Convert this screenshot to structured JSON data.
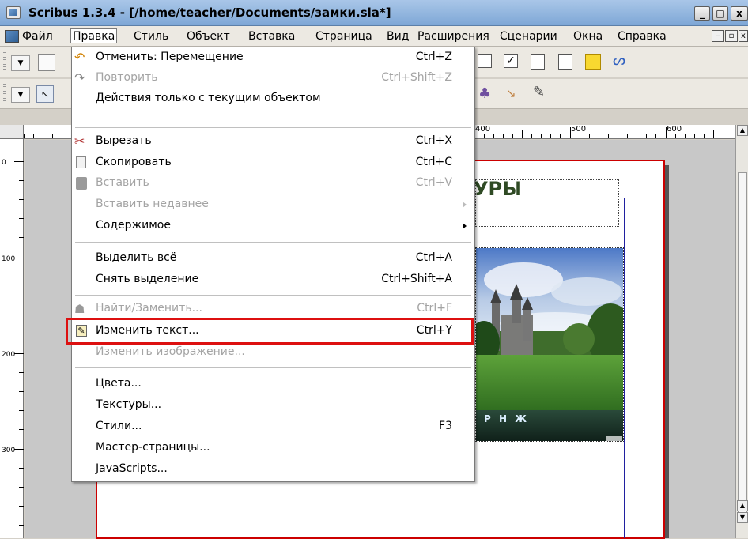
{
  "window": {
    "title": "Scribus 1.3.4 - [/home/teacher/Documents/замки.sla*]",
    "minimize_glyph": "_",
    "maximize_glyph": "□",
    "close_glyph": "x"
  },
  "menubar": {
    "items": [
      "Файл",
      "Правка",
      "Стиль",
      "Объект",
      "Вставка",
      "Страница",
      "Вид",
      "Расширения",
      "Сценарии",
      "Окна",
      "Справка"
    ],
    "active_index": 1
  },
  "ruler": {
    "h_labels": [
      "400",
      "500",
      "600"
    ],
    "v_labels": [
      "0",
      "100",
      "200",
      "300"
    ]
  },
  "canvas": {
    "headline": "УРЫ",
    "photo_caption": "Р Н Ж"
  },
  "edit_menu": {
    "items": [
      {
        "label": "Отменить: Перемещение",
        "shortcut": "Ctrl+Z",
        "enabled": true,
        "icon": "undo-icon"
      },
      {
        "label": "Повторить",
        "shortcut": "Ctrl+Shift+Z",
        "enabled": false,
        "icon": "redo-icon"
      },
      {
        "label": "Действия только с текущим объектом",
        "shortcut": "",
        "enabled": true,
        "icon": ""
      },
      {
        "label": "Вырезать",
        "shortcut": "Ctrl+X",
        "enabled": true,
        "icon": "scissors-icon"
      },
      {
        "label": "Скопировать",
        "shortcut": "Ctrl+C",
        "enabled": true,
        "icon": "copy-icon"
      },
      {
        "label": "Вставить",
        "shortcut": "Ctrl+V",
        "enabled": false,
        "icon": "paste-icon"
      },
      {
        "label": "Вставить недавнее",
        "shortcut": "",
        "enabled": false,
        "icon": "",
        "submenu": true
      },
      {
        "label": "Содержимое",
        "shortcut": "",
        "enabled": true,
        "icon": "",
        "submenu": true
      },
      {
        "label": "Выделить всё",
        "shortcut": "Ctrl+A",
        "enabled": true,
        "icon": ""
      },
      {
        "label": "Снять выделение",
        "shortcut": "Ctrl+Shift+A",
        "enabled": true,
        "icon": ""
      },
      {
        "label": "Найти/Заменить...",
        "shortcut": "Ctrl+F",
        "enabled": false,
        "icon": "find-icon"
      },
      {
        "label": "Изменить текст...",
        "shortcut": "Ctrl+Y",
        "enabled": true,
        "icon": "edit-text-icon",
        "highlighted": true
      },
      {
        "label": "Изменить изображение...",
        "shortcut": "",
        "enabled": false,
        "icon": ""
      },
      {
        "label": "Цвета...",
        "shortcut": "",
        "enabled": true,
        "icon": ""
      },
      {
        "label": "Текстуры...",
        "shortcut": "",
        "enabled": true,
        "icon": ""
      },
      {
        "label": "Стили...",
        "shortcut": "F3",
        "enabled": true,
        "icon": ""
      },
      {
        "label": "Мастер-страницы...",
        "shortcut": "",
        "enabled": true,
        "icon": ""
      },
      {
        "label": "JavaScripts...",
        "shortcut": "",
        "enabled": true,
        "icon": ""
      }
    ]
  },
  "colors": {
    "highlight_border": "#dd1010",
    "page_border": "#cc0000",
    "disabled_text": "#a4a4a4"
  }
}
